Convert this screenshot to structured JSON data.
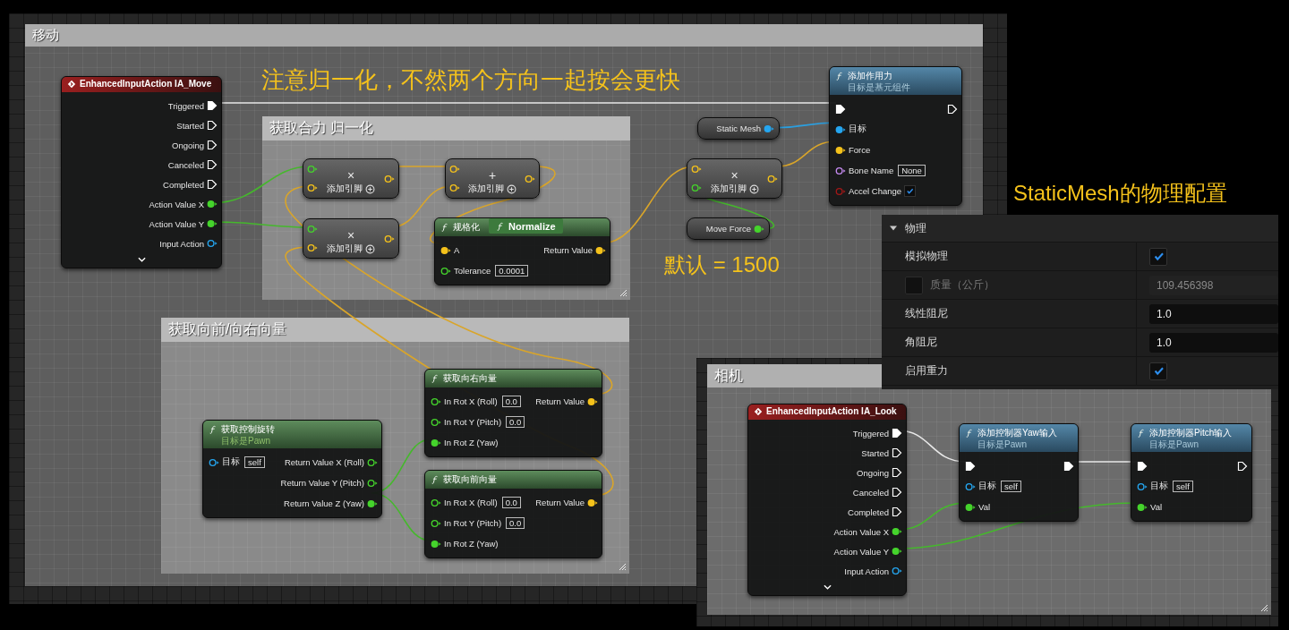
{
  "move_graph": {
    "comment": "移动",
    "groups": [
      {
        "title": "获取合力 归一化"
      },
      {
        "title": "获取向前/向右向量"
      }
    ],
    "notes": [
      "注意归一化，不然两个方向一起按会更快",
      "默认 = 1500"
    ],
    "nodes": [
      {
        "kind": "event",
        "title": "EnhancedInputAction IA_Move",
        "outputs": [
          {
            "label": "Triggered",
            "kind": "exec",
            "filled": true
          },
          {
            "label": "Started",
            "kind": "exec",
            "filled": false
          },
          {
            "label": "Ongoing",
            "kind": "exec",
            "filled": false
          },
          {
            "label": "Canceled",
            "kind": "exec",
            "filled": false
          },
          {
            "label": "Completed",
            "kind": "exec",
            "filled": false
          },
          {
            "label": "Action Value X",
            "kind": "float",
            "filled": true
          },
          {
            "label": "Action Value Y",
            "kind": "float",
            "filled": true
          },
          {
            "label": "Input Action",
            "kind": "object",
            "filled": false
          }
        ]
      },
      {
        "kind": "operator",
        "symbol": "×",
        "add_pin": "添加引脚",
        "inputs": [
          {
            "kind": "float",
            "filled": false
          },
          {
            "kind": "vector",
            "filled": false
          }
        ],
        "outputs": [
          {
            "kind": "vector",
            "filled": false
          }
        ]
      },
      {
        "kind": "operator",
        "symbol": "+",
        "add_pin": "添加引脚",
        "inputs": [
          {
            "kind": "vector",
            "filled": false
          },
          {
            "kind": "vector",
            "filled": false
          }
        ],
        "outputs": [
          {
            "kind": "vector",
            "filled": false
          }
        ]
      },
      {
        "kind": "operator",
        "symbol": "×",
        "add_pin": "添加引脚",
        "inputs": [
          {
            "kind": "float",
            "filled": false
          },
          {
            "kind": "vector",
            "filled": false
          }
        ],
        "outputs": [
          {
            "kind": "vector",
            "filled": false
          }
        ]
      },
      {
        "kind": "pure_function",
        "title": "规格化",
        "title_overlay": "Normalize",
        "inputs": [
          {
            "label": "A",
            "kind": "vector",
            "filled": true
          },
          {
            "label": "Tolerance",
            "kind": "float",
            "filled": false,
            "value": "0.0001"
          }
        ],
        "outputs": [
          {
            "label": "Return Value",
            "kind": "vector",
            "filled": true
          }
        ]
      },
      {
        "kind": "variable",
        "label": "Static Mesh",
        "pin": {
          "kind": "object",
          "filled": true
        }
      },
      {
        "kind": "operator",
        "symbol": "×",
        "add_pin": "添加引脚",
        "inputs": [
          {
            "kind": "vector",
            "filled": false
          },
          {
            "kind": "float",
            "filled": false
          }
        ],
        "outputs": [
          {
            "kind": "vector",
            "filled": false
          }
        ]
      },
      {
        "kind": "variable",
        "label": "Move Force",
        "pin": {
          "kind": "float",
          "filled": true
        }
      },
      {
        "kind": "function",
        "title": "添加作用力",
        "subtitle": "目标是基元组件",
        "inputs": [
          {
            "kind": "exec",
            "filled": true
          },
          {
            "label": "目标",
            "kind": "object",
            "filled": true
          },
          {
            "label": "Force",
            "kind": "vector",
            "filled": true
          },
          {
            "label": "Bone Name",
            "kind": "name",
            "filled": false,
            "value": "None"
          },
          {
            "label": "Accel Change",
            "kind": "bool",
            "filled": false,
            "checked": true
          }
        ],
        "outputs": [
          {
            "kind": "exec",
            "filled": false
          }
        ]
      },
      {
        "kind": "pure_function",
        "title": "获取控制旋转",
        "subtitle": "目标是Pawn",
        "inputs": [
          {
            "label": "目标",
            "kind": "object",
            "filled": false,
            "value": "self"
          }
        ],
        "outputs": [
          {
            "label": "Return Value X (Roll)",
            "kind": "float",
            "filled": false
          },
          {
            "label": "Return Value Y (Pitch)",
            "kind": "float",
            "filled": false
          },
          {
            "label": "Return Value Z (Yaw)",
            "kind": "float",
            "filled": true
          }
        ]
      },
      {
        "kind": "pure_function",
        "title": "获取向右向量",
        "inputs": [
          {
            "label": "In Rot X (Roll)",
            "kind": "float",
            "filled": false,
            "value": "0.0"
          },
          {
            "label": "In Rot Y (Pitch)",
            "kind": "float",
            "filled": false,
            "value": "0.0"
          },
          {
            "label": "In Rot Z (Yaw)",
            "kind": "float",
            "filled": true
          }
        ],
        "outputs": [
          {
            "label": "Return Value",
            "kind": "vector",
            "filled": true
          }
        ]
      },
      {
        "kind": "pure_function",
        "title": "获取向前向量",
        "inputs": [
          {
            "label": "In Rot X (Roll)",
            "kind": "float",
            "filled": false,
            "value": "0.0"
          },
          {
            "label": "In Rot Y (Pitch)",
            "kind": "float",
            "filled": false,
            "value": "0.0"
          },
          {
            "label": "In Rot Z (Yaw)",
            "kind": "float",
            "filled": true
          }
        ],
        "outputs": [
          {
            "label": "Return Value",
            "kind": "vector",
            "filled": true
          }
        ]
      }
    ]
  },
  "physics_caption": "StaticMesh的物理配置",
  "physics_panel": {
    "category": {
      "label": "物理",
      "expanded": true
    },
    "rows": [
      {
        "kind": "checkbox",
        "label": "模拟物理",
        "checked": true,
        "disabled": false
      },
      {
        "kind": "number",
        "label": "质量（公斤）",
        "value": "109.456398",
        "disabled": true,
        "override": false
      },
      {
        "kind": "number",
        "label": "线性阻尼",
        "value": "1.0",
        "disabled": false
      },
      {
        "kind": "number",
        "label": "角阻尼",
        "value": "1.0",
        "disabled": false
      },
      {
        "kind": "checkbox",
        "label": "启用重力",
        "checked": true,
        "disabled": false
      }
    ]
  },
  "camera_graph": {
    "comment": "相机",
    "nodes": [
      {
        "kind": "event",
        "title": "EnhancedInputAction IA_Look",
        "outputs": [
          {
            "label": "Triggered",
            "kind": "exec",
            "filled": true
          },
          {
            "label": "Started",
            "kind": "exec",
            "filled": false
          },
          {
            "label": "Ongoing",
            "kind": "exec",
            "filled": false
          },
          {
            "label": "Canceled",
            "kind": "exec",
            "filled": false
          },
          {
            "label": "Completed",
            "kind": "exec",
            "filled": false
          },
          {
            "label": "Action Value X",
            "kind": "float",
            "filled": true
          },
          {
            "label": "Action Value Y",
            "kind": "float",
            "filled": true
          },
          {
            "label": "Input Action",
            "kind": "object",
            "filled": false
          }
        ]
      },
      {
        "kind": "function",
        "title": "添加控制器Yaw输入",
        "subtitle": "目标是Pawn",
        "inputs": [
          {
            "kind": "exec",
            "filled": true
          },
          {
            "label": "目标",
            "kind": "object",
            "filled": false,
            "value": "self"
          },
          {
            "label": "Val",
            "kind": "float",
            "filled": true
          }
        ],
        "outputs": [
          {
            "kind": "exec",
            "filled": true
          }
        ]
      },
      {
        "kind": "function",
        "title": "添加控制器Pitch输入",
        "subtitle": "目标是Pawn",
        "inputs": [
          {
            "kind": "exec",
            "filled": true
          },
          {
            "label": "目标",
            "kind": "object",
            "filled": false,
            "value": "self"
          },
          {
            "label": "Val",
            "kind": "float",
            "filled": true
          }
        ],
        "outputs": [
          {
            "kind": "exec",
            "filled": false
          }
        ]
      }
    ]
  }
}
